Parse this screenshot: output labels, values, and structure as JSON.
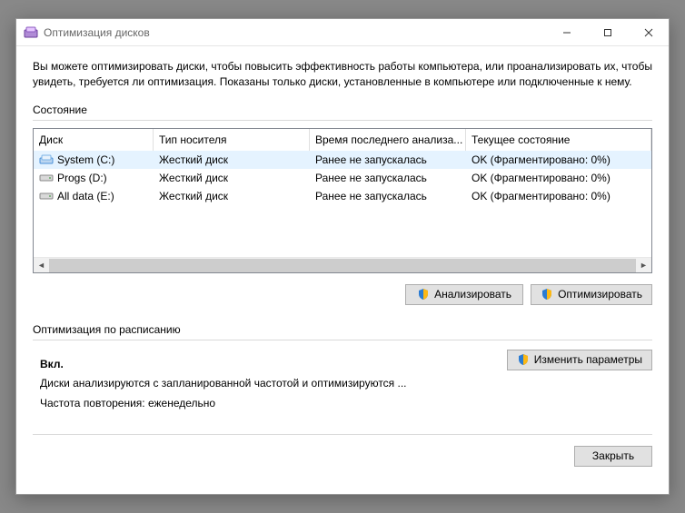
{
  "window": {
    "title": "Оптимизация дисков"
  },
  "intro": "Вы можете оптимизировать диски, чтобы повысить эффективность работы  компьютера, или проанализировать их, чтобы увидеть, требуется ли оптимизация. Показаны только диски, установленные в компьютере или подключенные к нему.",
  "status_group_label": "Состояние",
  "table": {
    "columns": {
      "disk": "Диск",
      "media": "Тип носителя",
      "last": "Время последнего анализа...",
      "state": "Текущее состояние"
    },
    "rows": [
      {
        "disk": "System (C:)",
        "media": "Жесткий диск",
        "last": "Ранее не запускалась",
        "state": "OK (Фрагментировано: 0%)",
        "selected": true,
        "icon": "drive-system"
      },
      {
        "disk": "Progs (D:)",
        "media": "Жесткий диск",
        "last": "Ранее не запускалась",
        "state": "OK (Фрагментировано: 0%)",
        "selected": false,
        "icon": "drive"
      },
      {
        "disk": "All data (E:)",
        "media": "Жесткий диск",
        "last": "Ранее не запускалась",
        "state": "OK (Фрагментировано: 0%)",
        "selected": false,
        "icon": "drive"
      }
    ]
  },
  "buttons": {
    "analyze": "Анализировать",
    "optimize": "Оптимизировать",
    "change": "Изменить параметры",
    "close": "Закрыть"
  },
  "schedule": {
    "group_label": "Оптимизация по расписанию",
    "status": "Вкл.",
    "line1": "Диски анализируются с запланированной частотой и оптимизируются ...",
    "line2": "Частота повторения: еженедельно"
  }
}
